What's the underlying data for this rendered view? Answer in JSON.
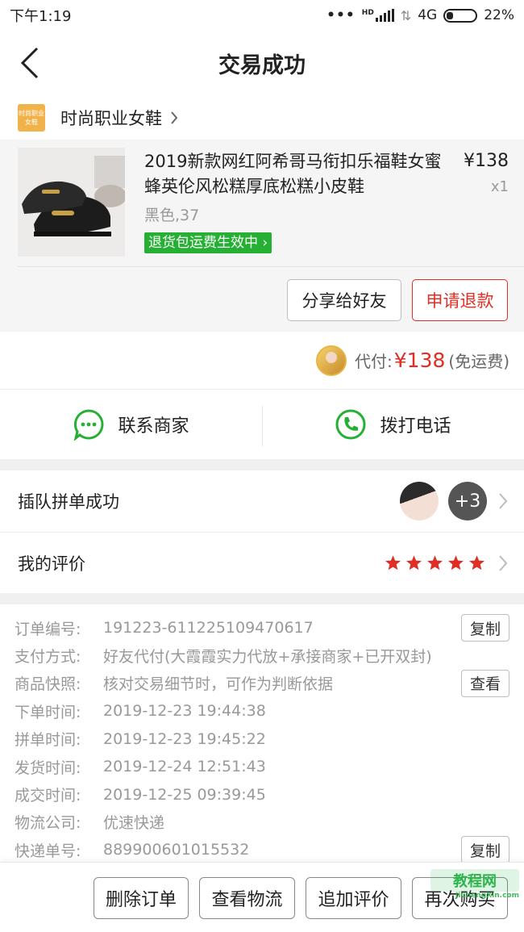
{
  "status_bar": {
    "time": "下午1:19",
    "hd": "HD",
    "network": "4G",
    "battery": "22%"
  },
  "header": {
    "title": "交易成功"
  },
  "shop": {
    "logo_text": "时尚职业女鞋",
    "name": "时尚职业女鞋"
  },
  "product": {
    "title": "2019新款网红阿希哥马衔扣乐福鞋女蜜蜂英伦风松糕厚底松糕小皮鞋",
    "price": "¥138",
    "qty": "x1",
    "spec": "黑色,37",
    "return_badge": "退货包运费生效中",
    "share_label": "分享给好友",
    "refund_label": "申请退款"
  },
  "payment": {
    "label": "代付:",
    "amount": "¥138",
    "note": "(免运费)"
  },
  "contact": {
    "merchant_label": "联系商家",
    "call_label": "拨打电话"
  },
  "group": {
    "label": "插队拼单成功",
    "more": "+3"
  },
  "review": {
    "label": "我的评价",
    "stars": 5
  },
  "order_info": {
    "rows": [
      {
        "key": "订单编号:",
        "value": "191223-611225109470617",
        "button": "复制"
      },
      {
        "key": "支付方式:",
        "value": "好友代付(大霞霞实力代放+承接商家+已开双封)"
      },
      {
        "key": "商品快照:",
        "value": "核对交易细节时，可作为判断依据",
        "button": "查看"
      },
      {
        "key": "下单时间:",
        "value": "2019-12-23 19:44:38"
      },
      {
        "key": "拼单时间:",
        "value": "2019-12-23 19:45:22"
      },
      {
        "key": "发货时间:",
        "value": "2019-12-24 12:51:43"
      },
      {
        "key": "成交时间:",
        "value": "2019-12-25 09:39:45"
      },
      {
        "key": "物流公司:",
        "value": "优速快递"
      },
      {
        "key": "快递单号:",
        "value": "889900601015532",
        "button": "复制"
      }
    ]
  },
  "bottom_bar": {
    "delete_label": "删除订单",
    "logistics_label": "查看物流",
    "add_review_label": "追加评价",
    "rebuy_label": "再次购买"
  },
  "watermark": {
    "logo": "教程网",
    "url": "JiChengXin.com"
  },
  "colors": {
    "accent": "#e02e24",
    "green": "#25b034",
    "star": "#e02e24"
  }
}
